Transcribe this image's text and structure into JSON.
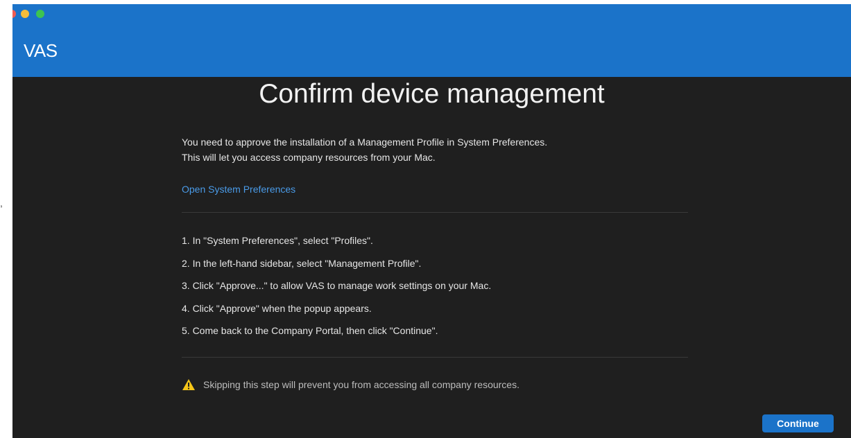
{
  "window": {
    "app_title": "VAS"
  },
  "main": {
    "heading": "Confirm device management",
    "intro_line1": "You need to approve the installation of a Management Profile in System Preferences.",
    "intro_line2": "This will let you access company resources from your Mac.",
    "open_prefs_link": "Open System Preferences",
    "steps": [
      "1.  In \"System Preferences\", select \"Profiles\".",
      "2.  In the left-hand sidebar, select \"Management Profile\".",
      "3.  Click \"Approve...\" to allow VAS to manage work settings on your Mac.",
      "4.  Click \"Approve\" when the popup appears.",
      "5.  Come back to the Company Portal, then click \"Continue\"."
    ],
    "warning_text": "Skipping this step will prevent you from accessing all company resources.",
    "warning_icon": "warning-triangle-icon"
  },
  "footer": {
    "continue_label": "Continue"
  },
  "colors": {
    "titlebar": "#1b73c9",
    "background": "#1f1f1f",
    "link": "#4a9be8",
    "button": "#1b73c9",
    "warning_icon": "#f5c518"
  }
}
